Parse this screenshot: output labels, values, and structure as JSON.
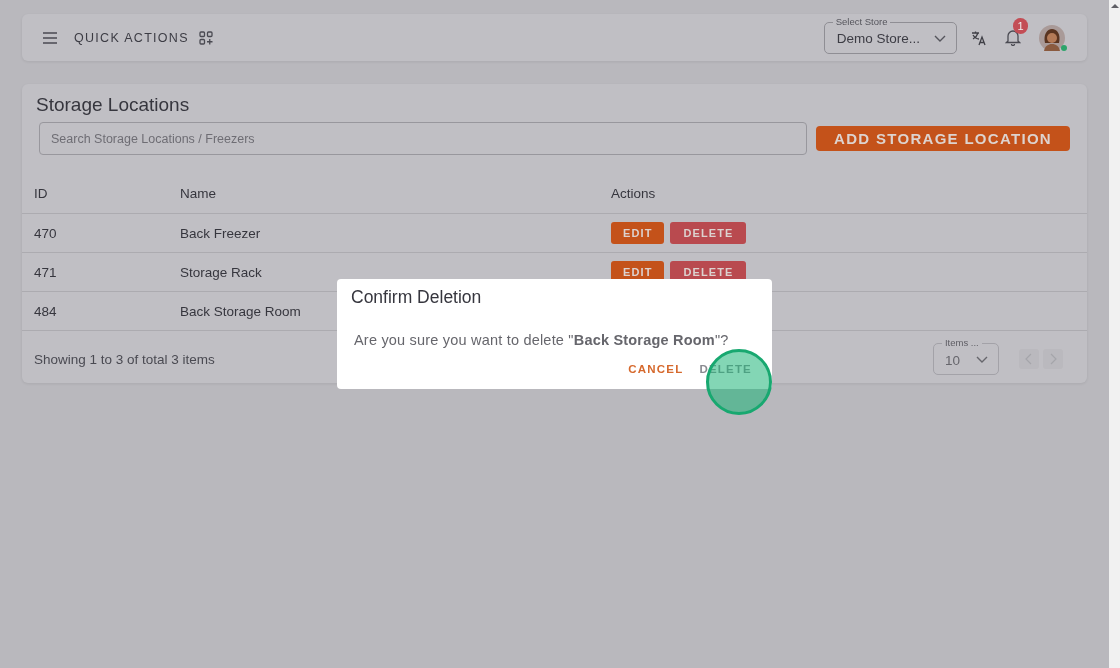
{
  "header": {
    "quick_actions": "QUICK ACTIONS",
    "store_select": {
      "label": "Select Store",
      "value": "Demo Store..."
    },
    "notifications": {
      "badge": "1"
    },
    "avatar": {
      "online": true
    }
  },
  "page": {
    "title": "Storage Locations",
    "search": {
      "placeholder": "Search Storage Locations / Freezers"
    },
    "add_button": "ADD STORAGE LOCATION"
  },
  "table": {
    "columns": [
      "ID",
      "Name",
      "Actions"
    ],
    "rows": [
      {
        "id": "470",
        "name": "Back Freezer",
        "actions": [
          "EDIT",
          "DELETE"
        ]
      },
      {
        "id": "471",
        "name": "Storage Rack",
        "actions": [
          "EDIT",
          "DELETE"
        ]
      },
      {
        "id": "484",
        "name": "Back Storage Room"
      }
    ]
  },
  "footer": {
    "summary": "Showing 1 to 3 of total 3 items",
    "page_size": {
      "label": "Items ...",
      "value": "10"
    }
  },
  "dialog": {
    "title": "Confirm Deletion",
    "message": "Are you sure you want to delete \"**Back Storage Room**\"?",
    "buttons": [
      {
        "label": "CANCEL",
        "kind": "cancel"
      },
      {
        "label": "DELETE",
        "kind": "confirm"
      }
    ],
    "click_marker": true
  }
}
